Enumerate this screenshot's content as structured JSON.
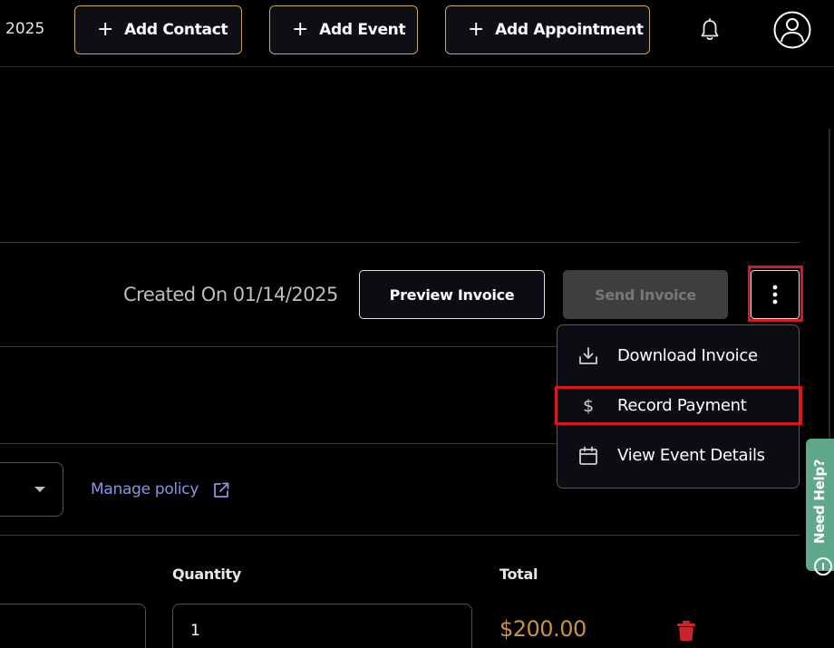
{
  "header": {
    "year_fragment": "2025",
    "add_contact_label": "Add Contact",
    "add_event_label": "Add Event",
    "add_appointment_label": "Add Appointment",
    "plus_glyph": "+"
  },
  "invoice_bar": {
    "created_text": "Created On 01/14/2025",
    "preview_label": "Preview Invoice",
    "send_label": "Send Invoice"
  },
  "actions_menu": {
    "items": [
      {
        "label": "Download Invoice",
        "icon": "download-icon"
      },
      {
        "label": "Record Payment",
        "icon": "dollar-icon"
      },
      {
        "label": "View Event Details",
        "icon": "calendar-icon"
      }
    ],
    "dollar_glyph": "$"
  },
  "policy": {
    "manage_label": "Manage policy"
  },
  "line_items": {
    "quantity_header": "Quantity",
    "total_header": "Total",
    "quantity_value": "1",
    "total_value": "$200.00"
  },
  "help": {
    "label": "Need Help?"
  },
  "colors": {
    "gold_border": "#c9a45c",
    "link": "#8b93e6",
    "total_amount": "#c99245",
    "delete_red": "#c4262e",
    "help_tab": "#5fa88a",
    "highlight_red": "#d8191c"
  }
}
